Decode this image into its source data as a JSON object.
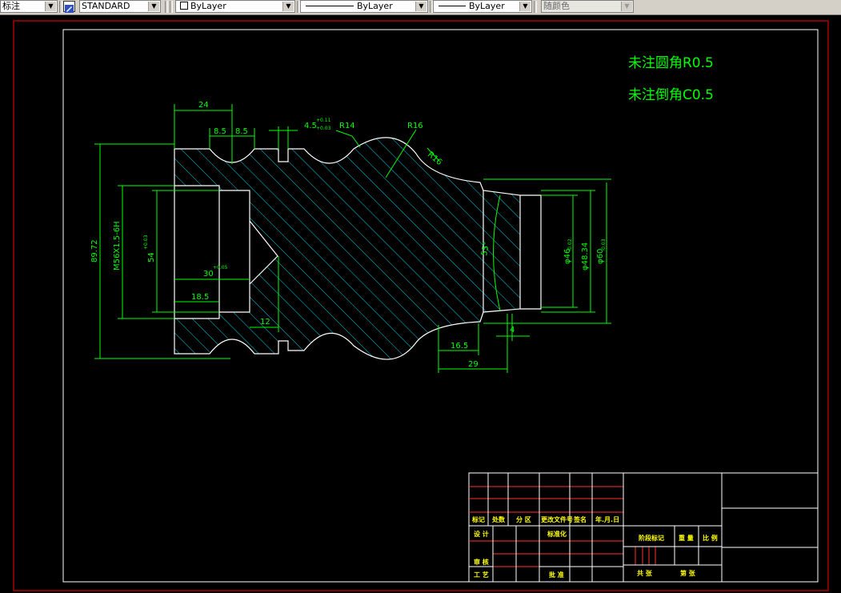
{
  "toolbar": {
    "dimstyle_prefix": "标注",
    "textstyle_value": "STANDARD",
    "layer_value": "ByLayer",
    "linetype_value": "ByLayer",
    "lineweight_value": "ByLayer",
    "color_value": "随颜色"
  },
  "notes": {
    "fillet": "未注圆角R0.5",
    "chamfer": "未注倒角C0.5"
  },
  "dimensions": {
    "d24": "24",
    "d8_5a": "8.5",
    "d8_5b": "8.5",
    "d4_5": "4.5",
    "d4_5_tol_upper": "+0.11",
    "d4_5_tol_lower": "+0.03",
    "r14": "R14",
    "r16": "R16",
    "r16b": "R16",
    "d89_72": "89.72",
    "thread": "M56X1.5-6H",
    "d54": "54",
    "d54_tol": "+0.03",
    "d30": "30",
    "d30_tol": "+0.05",
    "d18_5": "18.5",
    "d12": "12",
    "angle55": "55°",
    "phi46": "φ46",
    "phi46_tol": "-0.02",
    "phi48_34": "φ48.34",
    "phi60": "φ60",
    "phi60_tol": "-0.03",
    "d16_5": "16.5",
    "d29": "29",
    "d4": "4"
  },
  "title_block": {
    "marker": "标记",
    "count": "处数",
    "zone": "分 区",
    "change_doc": "更改文件号",
    "signature": "签名",
    "date": "年.月.日",
    "design": "设 计",
    "standardize": "标准化",
    "review": "审 核",
    "process": "工 艺",
    "approve": "批 准",
    "stage_mark": "阶段标记",
    "weight": "重 量",
    "scale": "比 例",
    "total_sheets": "共   张",
    "sheet_no": "第   张"
  },
  "colors": {
    "canvas_bg": "#000000",
    "outline": "#ffffff",
    "dimension": "#00ff00",
    "hatch": "#00e5ff",
    "frame_red": "#ff0000",
    "title_red": "#ff3030",
    "text_yellow": "#ffff00"
  }
}
